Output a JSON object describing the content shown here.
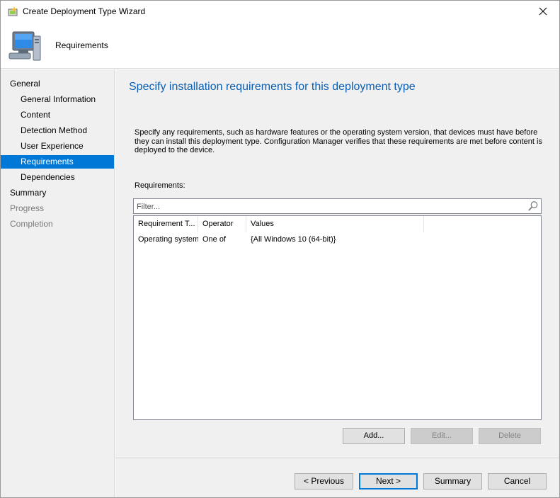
{
  "window": {
    "title": "Create Deployment Type Wizard",
    "close_icon": "close-icon"
  },
  "header": {
    "title": "Requirements",
    "icon": "computer-icon"
  },
  "nav": {
    "items": [
      {
        "label": "General",
        "level": 1,
        "state": "normal"
      },
      {
        "label": "General Information",
        "level": 2,
        "state": "normal"
      },
      {
        "label": "Content",
        "level": 2,
        "state": "normal"
      },
      {
        "label": "Detection Method",
        "level": 2,
        "state": "normal"
      },
      {
        "label": "User Experience",
        "level": 2,
        "state": "normal"
      },
      {
        "label": "Requirements",
        "level": 2,
        "state": "selected"
      },
      {
        "label": "Dependencies",
        "level": 2,
        "state": "normal"
      },
      {
        "label": "Summary",
        "level": 1,
        "state": "normal"
      },
      {
        "label": "Progress",
        "level": 1,
        "state": "disabled"
      },
      {
        "label": "Completion",
        "level": 1,
        "state": "disabled"
      }
    ]
  },
  "main": {
    "heading": "Specify installation requirements for this deployment type",
    "description": "Specify any requirements, such as hardware features or the operating system version, that devices must have before they can install this deployment type. Configuration Manager verifies that these requirements are met before content is deployed to the device.",
    "requirements_label": "Requirements:",
    "filter": {
      "placeholder": "Filter...",
      "value": ""
    },
    "table": {
      "columns": [
        "Requirement T...",
        "Operator",
        "Values"
      ],
      "rows": [
        [
          "Operating system",
          "One of",
          "{All Windows 10 (64-bit)}"
        ]
      ]
    },
    "buttons": {
      "add": "Add...",
      "edit": "Edit...",
      "delete": "Delete"
    }
  },
  "footer": {
    "previous": "< Previous",
    "next": "Next >",
    "summary": "Summary",
    "cancel": "Cancel"
  },
  "colors": {
    "selection": "#0078d7",
    "heading": "#0a5fb4",
    "panel": "#f0f0f0"
  }
}
